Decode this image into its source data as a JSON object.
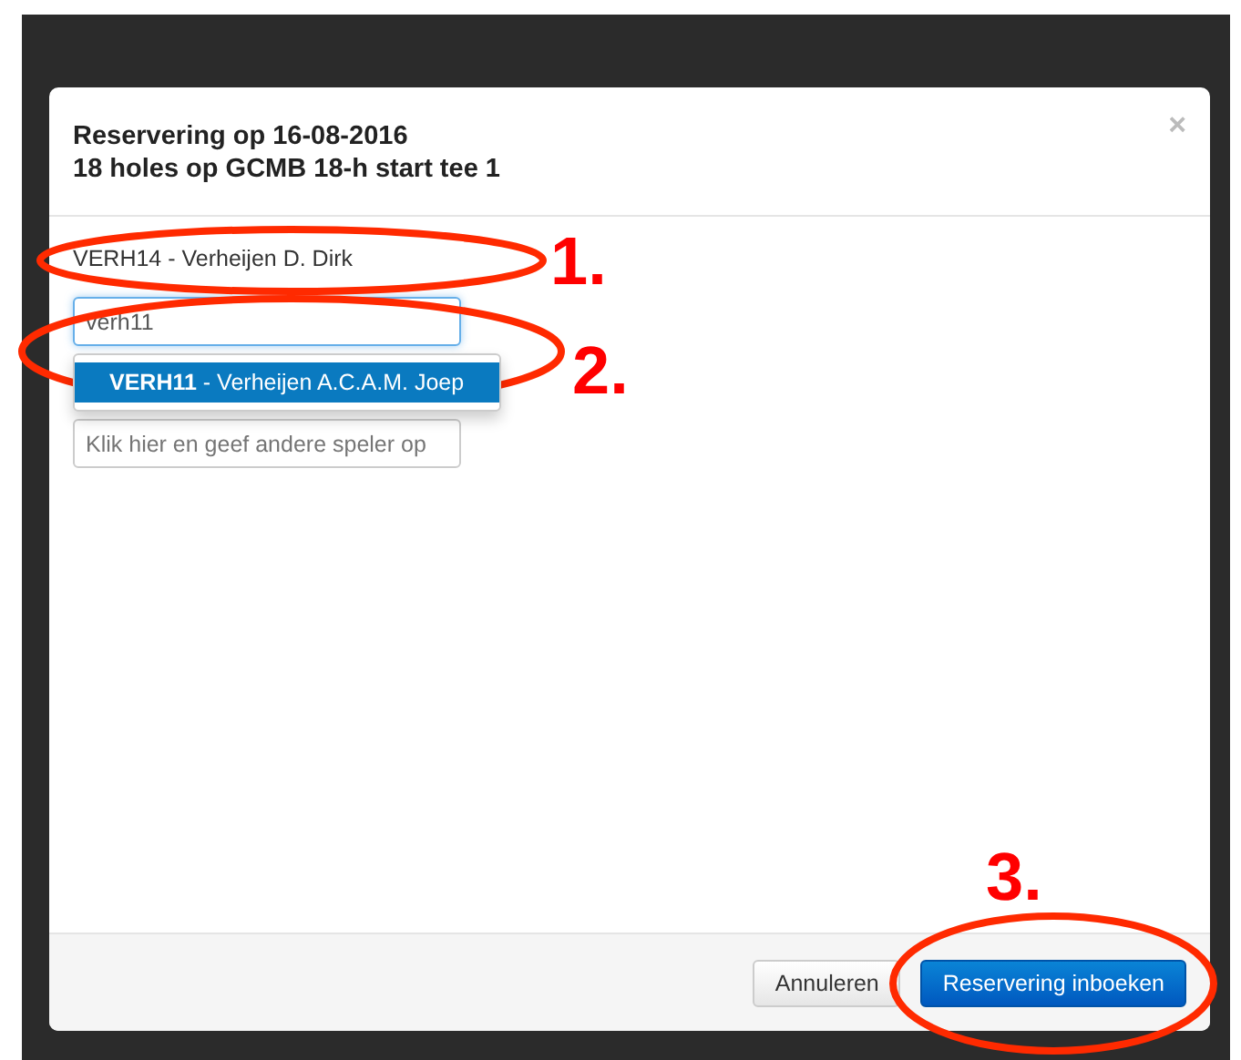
{
  "dialog": {
    "title_lines": [
      "Reservering op 16-08-2016",
      "18 holes op GCMB 18-h start tee 1"
    ],
    "close": "×"
  },
  "players": {
    "confirmed": "VERH14 - Verheijen D. Dirk",
    "search_value": "verh11",
    "suggestions": [
      {
        "text": "**VERH11** - Verheijen A.C.A.M. Joep",
        "selected": true
      }
    ],
    "next_placeholder": "Klik hier en geef andere speler op"
  },
  "buttons": [
    {
      "label": "Annuleren",
      "kind": "default"
    },
    {
      "label": "Reservering inboeken",
      "kind": "primary"
    }
  ],
  "annotations": [
    {
      "label": "1."
    },
    {
      "label": "2."
    },
    {
      "label": "3."
    }
  ]
}
